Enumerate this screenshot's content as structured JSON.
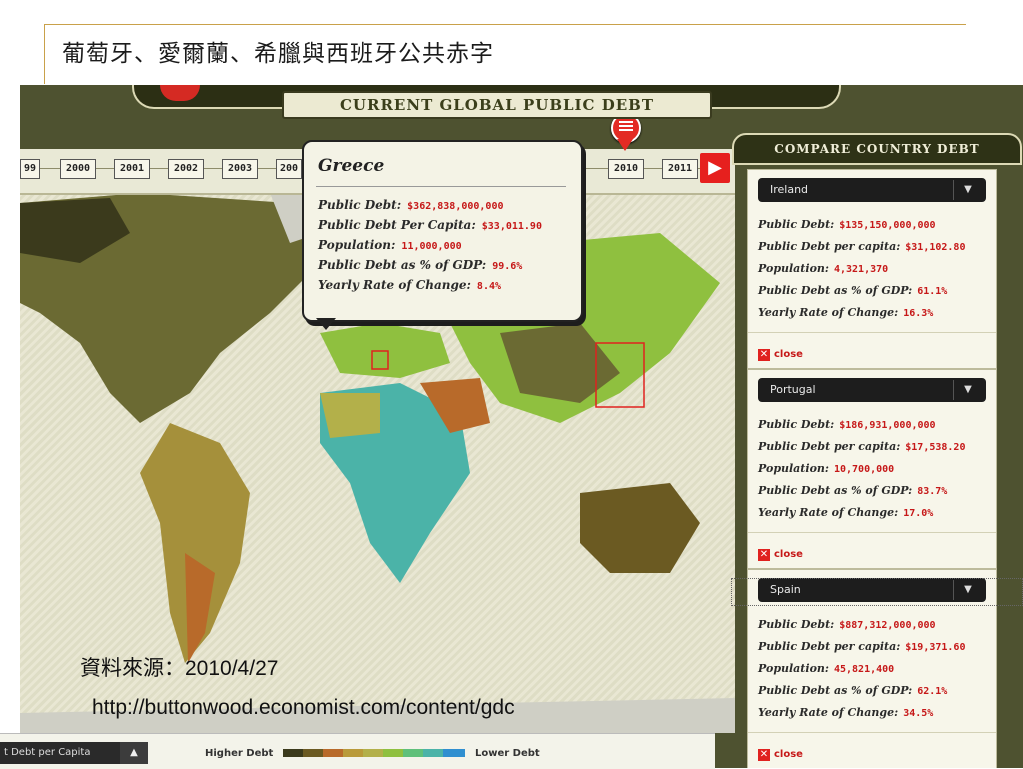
{
  "slide": {
    "title": "葡萄牙、愛爾蘭、希臘與西班牙公共赤字",
    "source": "資料來源：2010/4/27",
    "url": "http://buttonwood.economist.com/content/gdc"
  },
  "app": {
    "header_title": "CURRENT GLOBAL PUBLIC DEBT",
    "years": [
      "99",
      "2000",
      "2001",
      "2002",
      "2003",
      "200",
      "2010",
      "2011"
    ],
    "selected_year": "2010",
    "next_icon": "▶"
  },
  "tooltip": {
    "country": "Greece",
    "rows": [
      {
        "label": "Public Debt:",
        "value": "$362,838,000,000"
      },
      {
        "label": "Public Debt Per Capita:",
        "value": "$33,011.90"
      },
      {
        "label": "Population:",
        "value": "11,000,000"
      },
      {
        "label": "Public Debt as % of GDP:",
        "value": "99.6%"
      },
      {
        "label": "Yearly Rate of Change:",
        "value": "8.4%"
      }
    ]
  },
  "compare": {
    "header": "COMPARE COUNTRY DEBT",
    "close_label": "close",
    "panels": [
      {
        "country": "Ireland",
        "rows": [
          {
            "label": "Public Debt:",
            "value": "$135,150,000,000"
          },
          {
            "label": "Public Debt per capita:",
            "value": "$31,102.80"
          },
          {
            "label": "Population:",
            "value": "4,321,370"
          },
          {
            "label": "Public Debt as % of GDP:",
            "value": "61.1%"
          },
          {
            "label": "Yearly Rate of Change:",
            "value": "16.3%"
          }
        ]
      },
      {
        "country": "Portugal",
        "rows": [
          {
            "label": "Public Debt:",
            "value": "$186,931,000,000"
          },
          {
            "label": "Public Debt per capita:",
            "value": "$17,538.20"
          },
          {
            "label": "Population:",
            "value": "10,700,000"
          },
          {
            "label": "Public Debt as % of GDP:",
            "value": "83.7%"
          },
          {
            "label": "Yearly Rate of Change:",
            "value": "17.0%"
          }
        ]
      },
      {
        "country": "Spain",
        "rows": [
          {
            "label": "Public Debt:",
            "value": "$887,312,000,000"
          },
          {
            "label": "Public Debt per capita:",
            "value": "$19,371.60"
          },
          {
            "label": "Population:",
            "value": "45,821,400"
          },
          {
            "label": "Public Debt as % of GDP:",
            "value": "62.1%"
          },
          {
            "label": "Yearly Rate of Change:",
            "value": "34.5%"
          }
        ]
      }
    ]
  },
  "legend": {
    "metric_selected": "t Debt per Capita",
    "higher_label": "Higher Debt",
    "lower_label": "Lower Debt",
    "colors": [
      "#3b3a1c",
      "#6b5a22",
      "#b86a2a",
      "#b99a3a",
      "#b3b04a",
      "#8fc03f",
      "#5fc07a",
      "#4bb3a8",
      "#2f8fd0"
    ]
  },
  "icons": {
    "dropdown_arrow": "chevron-down-icon",
    "close": "close-icon",
    "next": "arrow-right-icon",
    "marker": "map-pin-icon"
  }
}
